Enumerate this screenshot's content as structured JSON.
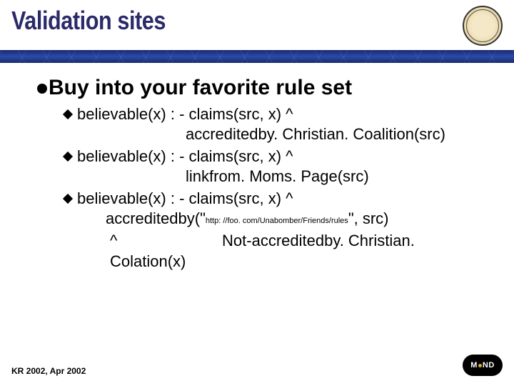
{
  "title": "Validation sites",
  "main_bullet": "Buy into your favorite rule set",
  "rules": [
    {
      "head": "believable(x) : - claims(src, x) ^",
      "cont": "accreditedby. Christian. Coalition(src)"
    },
    {
      "head": "believable(x) : - claims(src, x) ^",
      "cont": "linkfrom. Moms. Page(src)"
    },
    {
      "head": "believable(x) : - claims(src, x) ^",
      "cont_prefix": "accreditedby(\"",
      "cont_tiny": "http: //foo. com/Unabomber/Friends/rules",
      "cont_suffix": "\", src)"
    }
  ],
  "last_caret": "^",
  "last_line_spacer": "                        ",
  "last_line": "Not-accreditedby. Christian. Colation(x)",
  "footer": "KR 2002, Apr 2002",
  "logo_text": "M",
  "logo_text2": "ND"
}
